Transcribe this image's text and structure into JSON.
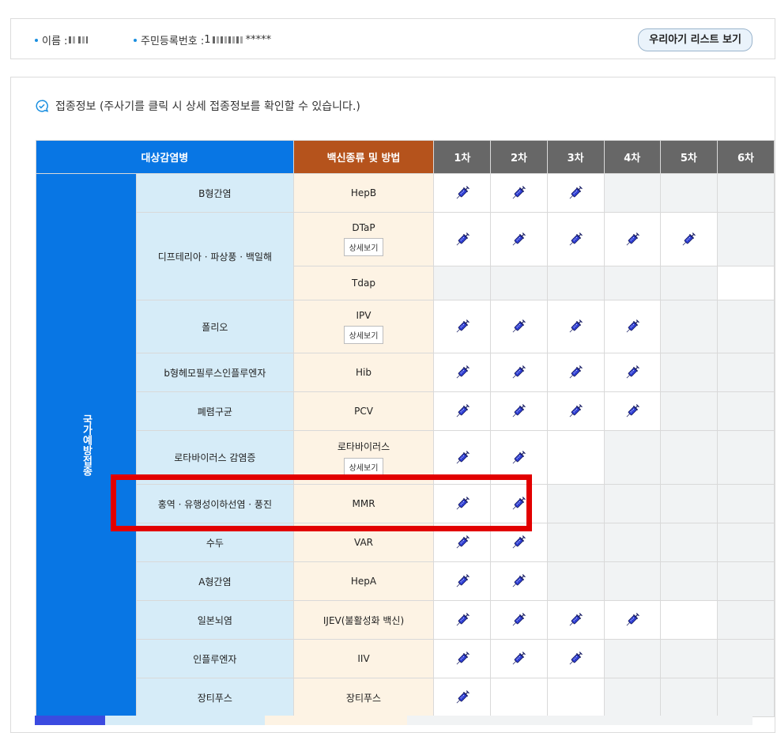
{
  "patient": {
    "name_label": "이름 :",
    "rrn_label": "주민등록번호 :",
    "rrn_prefix": "1",
    "rrn_suffix": "*****",
    "list_button": "우리아기 리스트 보기"
  },
  "section": {
    "title": "접종정보 (주사기를 클릭 시 상세 접종정보를 확인할 수 있습니다.)",
    "icon": "chat-check-icon"
  },
  "table": {
    "headers": {
      "disease": "대상감염병",
      "vaccine": "백신종류 및 방법",
      "doses": [
        "1차",
        "2차",
        "3차",
        "4차",
        "5차",
        "6차"
      ]
    },
    "group_label": "국가예방접종",
    "detail_label": "상세보기",
    "rows": [
      {
        "disease": "B형간염",
        "vaccine": "HepB",
        "detail": false,
        "doses": [
          true,
          true,
          true,
          false,
          false,
          false
        ]
      },
      {
        "disease": "디프테리아 · 파상풍 · 백일해",
        "vaccine": "DTaP",
        "detail": true,
        "doses": [
          true,
          true,
          true,
          true,
          true,
          false
        ]
      },
      {
        "disease": "",
        "vaccine": "Tdap",
        "detail": false,
        "doses": [
          false,
          false,
          false,
          false,
          false,
          false
        ]
      },
      {
        "disease": "폴리오",
        "vaccine": "IPV",
        "detail": true,
        "doses": [
          true,
          true,
          true,
          true,
          false,
          false
        ]
      },
      {
        "disease": "b형헤모필루스인플루엔자",
        "vaccine": "Hib",
        "detail": false,
        "doses": [
          true,
          true,
          true,
          true,
          false,
          false
        ]
      },
      {
        "disease": "폐렴구균",
        "vaccine": "PCV",
        "detail": false,
        "doses": [
          true,
          true,
          true,
          true,
          false,
          false
        ]
      },
      {
        "disease": "로타바이러스 감염증",
        "vaccine": "로타바이러스",
        "detail": true,
        "doses": [
          true,
          true,
          false,
          false,
          false,
          false
        ]
      },
      {
        "disease": "홍역 · 유행성이하선염 · 풍진",
        "vaccine": "MMR",
        "detail": false,
        "doses": [
          true,
          true,
          false,
          false,
          false,
          false
        ]
      },
      {
        "disease": "수두",
        "vaccine": "VAR",
        "detail": false,
        "doses": [
          true,
          true,
          false,
          false,
          false,
          false
        ]
      },
      {
        "disease": "A형간염",
        "vaccine": "HepA",
        "detail": false,
        "doses": [
          true,
          true,
          false,
          false,
          false,
          false
        ]
      },
      {
        "disease": "일본뇌염",
        "vaccine": "IJEV(불활성화 백신)",
        "detail": false,
        "doses": [
          true,
          true,
          true,
          true,
          false,
          false
        ]
      },
      {
        "disease": "인플루엔자",
        "vaccine": "IIV",
        "detail": false,
        "doses": [
          true,
          true,
          true,
          false,
          false,
          false
        ]
      },
      {
        "disease": "장티푸스",
        "vaccine": "장티푸스",
        "detail": false,
        "doses": [
          true,
          false,
          false,
          false,
          false,
          false
        ]
      }
    ]
  },
  "colors": {
    "accent_blue": "#0876e4",
    "vaccine_header": "#b5531c",
    "dose_header": "#676767",
    "highlight": "#e20000",
    "syringe": "#2f3fd6"
  }
}
